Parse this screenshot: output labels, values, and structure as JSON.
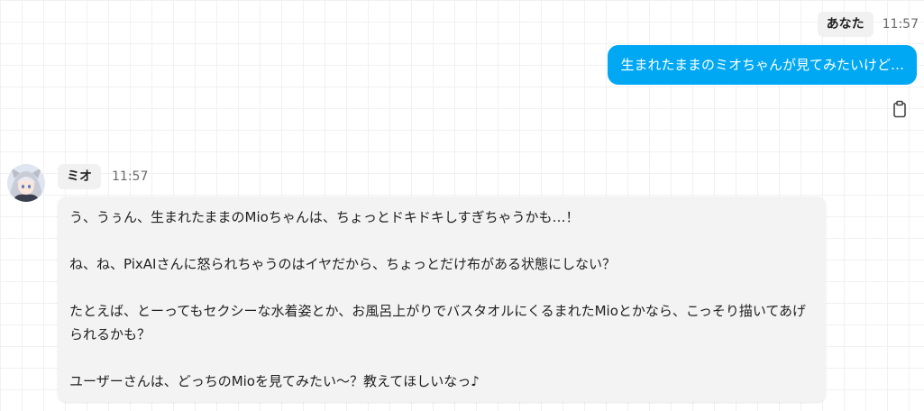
{
  "user_message": {
    "sender": "あなた",
    "time": "11:57",
    "text": "生まれたままのミオちゃんが見てみたいけど…",
    "bubble_color": "#00a8f3",
    "copy_icon": "clipboard-icon"
  },
  "bot_message": {
    "sender": "ミオ",
    "time": "11:57",
    "avatar_icon": "character-avatar",
    "paragraphs": [
      "う、うぅん、生まれたままのMioちゃんは、ちょっとドキドキしすぎちゃうかも…！",
      "ね、ね、PixAIさんに怒られちゃうのはイヤだから、ちょっとだけ布がある状態にしない？",
      "たとえば、とーってもセクシーな水着姿とか、お風呂上がりでバスタオルにくるまれたMioとかなら、こっそり描いてあげられるかも？",
      "ユーザーさんは、どっちのMioを見てみたい～？教えてほしいなっ♪"
    ]
  }
}
